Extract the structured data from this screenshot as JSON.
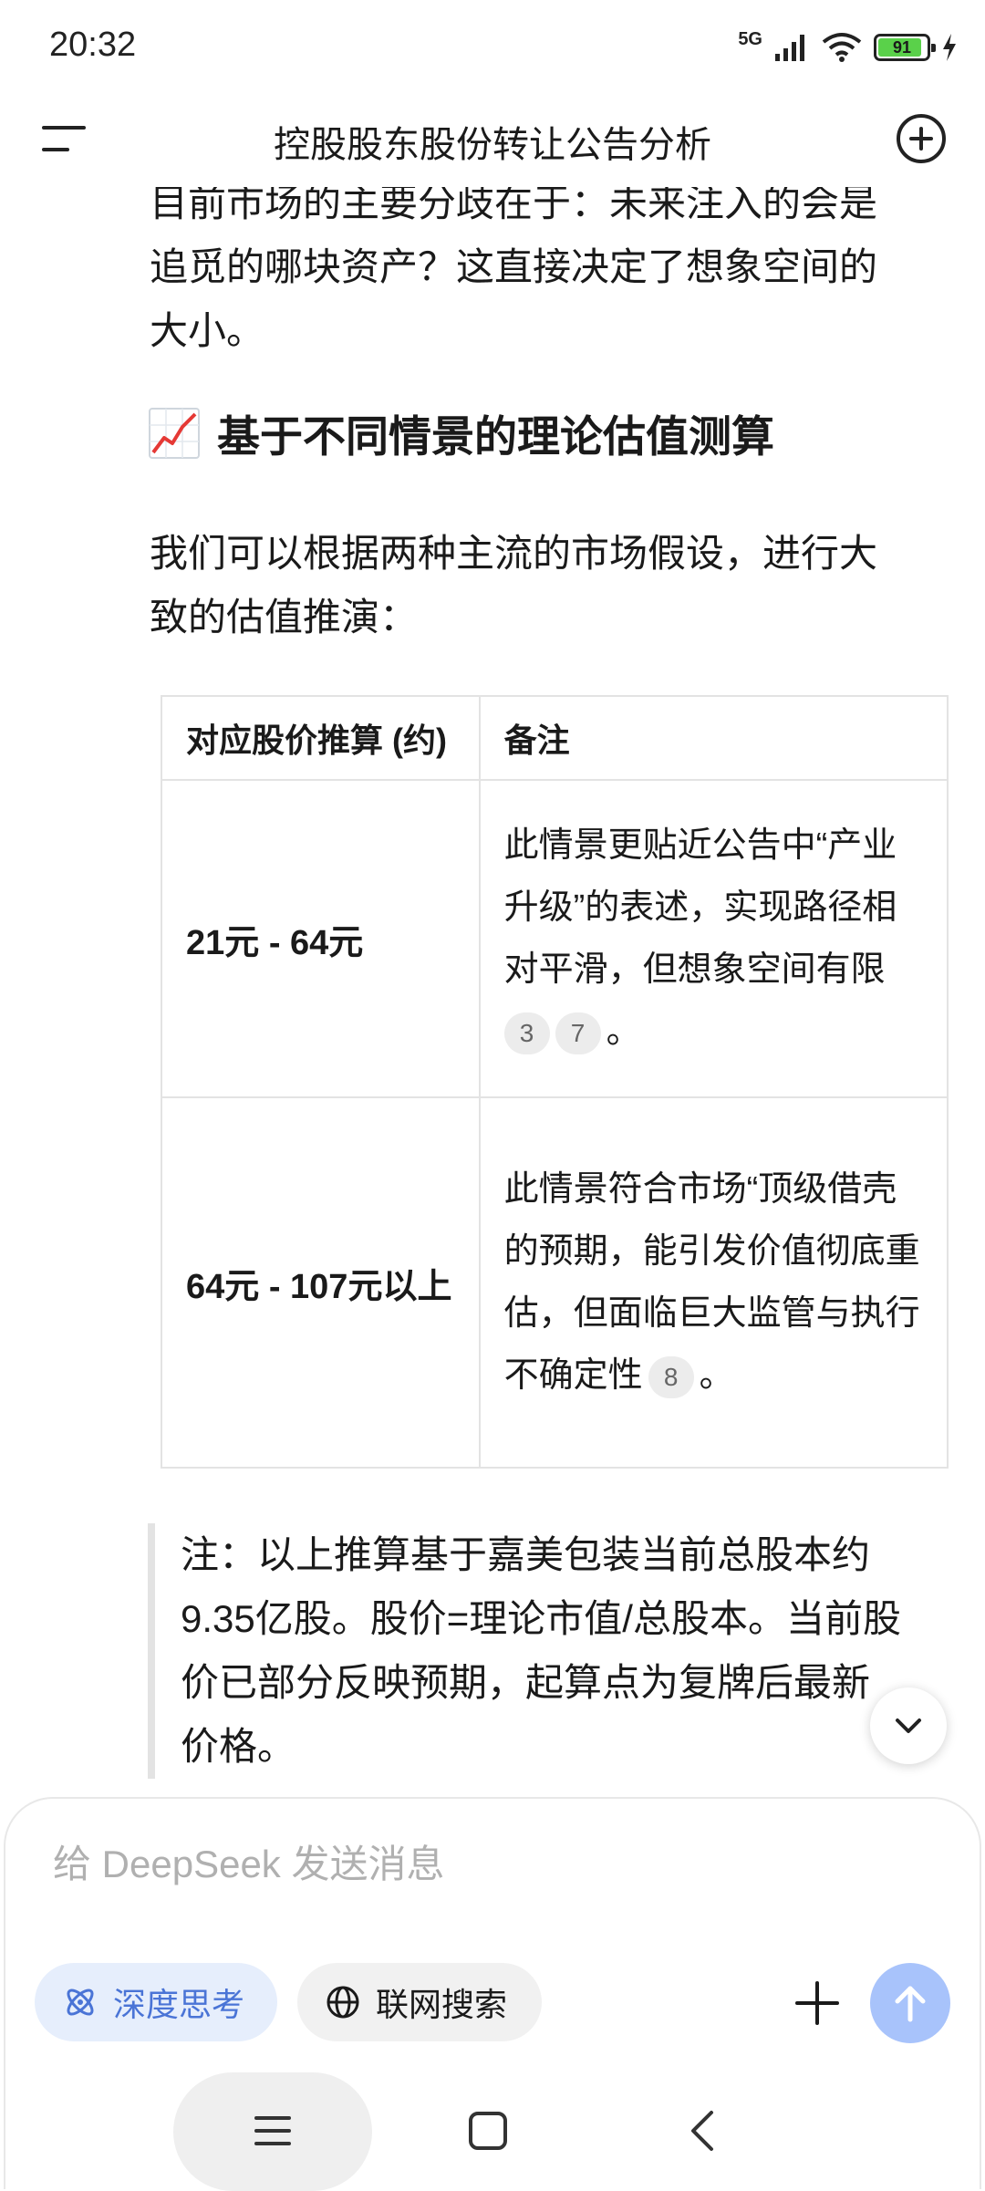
{
  "status_bar": {
    "time": "20:32",
    "network": "5G",
    "battery": "91",
    "icons": [
      "signal-icon",
      "wifi-icon",
      "battery-icon",
      "charging-icon"
    ]
  },
  "header": {
    "title": "控股股东股份转让公告分析",
    "icons": [
      "menu-icon",
      "new-chat-icon"
    ]
  },
  "content": {
    "intro_line1": "目前市场的主要分歧在于：未来注入的会是",
    "intro_line2": "追觅的哪块资产？这直接决定了想象空间的",
    "intro_line3": "大小。",
    "section_icon": "chart-increasing-icon",
    "section_title": "基于不同情景的理论估值测算",
    "lead_line1": "我们可以根据两种主流的市场假设，进行大",
    "lead_line2": "致的估值推演：",
    "table": {
      "headers": [
        "对应股价推算 (约)",
        "备注"
      ],
      "rows": [
        {
          "price": "21元 - 64元",
          "note_lines": [
            "此情景更贴近公告中“产业",
            "升级”的表述，实现路径相",
            "对平滑，但想象空间有限"
          ],
          "citations": [
            "3",
            "7"
          ],
          "note_end": "。"
        },
        {
          "price": "64元 - 107元以上",
          "note_lines": [
            "此情景符合市场“顶级借壳",
            "的预期，能引发价值彻底重",
            "估，但面临巨大监管与执行",
            "不确定性"
          ],
          "citations": [
            "8"
          ],
          "note_end": "。"
        }
      ]
    },
    "note_lines": [
      "注：以上推算基于嘉美包装当前总股本约",
      "9.35亿股。股价=理论市值/总股本。当前股",
      "价已部分反映预期，起算点为复牌后最新",
      "价格。"
    ]
  },
  "composer": {
    "placeholder": "给 DeepSeek 发送消息",
    "deep_think_label": "深度思考",
    "web_search_label": "联网搜索",
    "accent_color": "#4a74d6",
    "send_color": "#a8c3fb"
  }
}
